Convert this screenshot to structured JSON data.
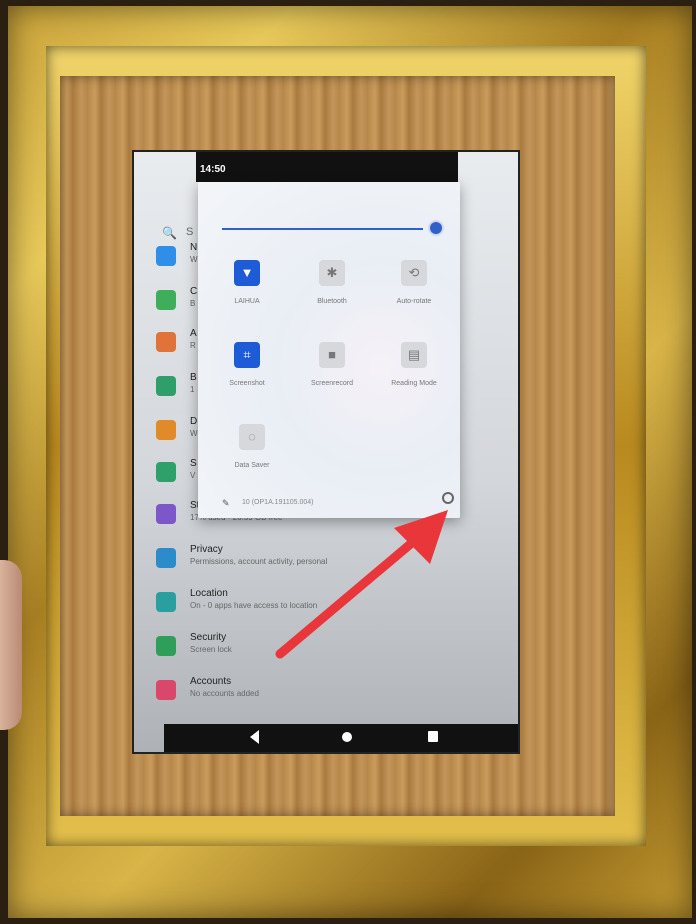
{
  "status_bar": {
    "time": "14:50"
  },
  "settings": {
    "search_hint": "S",
    "items": [
      {
        "title": "N",
        "subtitle": "W",
        "color": "#2f8ee8",
        "icon": "wifi-icon"
      },
      {
        "title": "C",
        "subtitle": "B",
        "color": "#3fae5a",
        "icon": "devices-icon"
      },
      {
        "title": "A",
        "subtitle": "R",
        "color": "#e0733a",
        "icon": "apps-icon"
      },
      {
        "title": "B",
        "subtitle": "1",
        "color": "#2e9e6a",
        "icon": "battery-icon"
      },
      {
        "title": "D",
        "subtitle": "W",
        "color": "#e08a2a",
        "icon": "display-icon"
      },
      {
        "title": "S",
        "subtitle": "V",
        "color": "#30a06a",
        "icon": "sound-icon"
      },
      {
        "title": "Storage",
        "subtitle": "17% used - 26.59 GB free",
        "color": "#7b57c9",
        "icon": "storage-icon"
      },
      {
        "title": "Privacy",
        "subtitle": "Permissions, account activity, personal",
        "color": "#2c8bc9",
        "icon": "privacy-icon"
      },
      {
        "title": "Location",
        "subtitle": "On - 0 apps have access to location",
        "color": "#2a9fa0",
        "icon": "location-icon"
      },
      {
        "title": "Security",
        "subtitle": "Screen lock",
        "color": "#2e9e5a",
        "icon": "lock-icon"
      },
      {
        "title": "Accounts",
        "subtitle": "No accounts added",
        "color": "#d9476a",
        "icon": "accounts-icon"
      }
    ]
  },
  "quick_settings": {
    "brightness_level": 0.95,
    "tiles": [
      {
        "label": "LAIHUA",
        "symbol": "▼",
        "active": true,
        "icon": "wifi-icon"
      },
      {
        "label": "Bluetooth",
        "symbol": "✱",
        "active": false,
        "icon": "bluetooth-icon"
      },
      {
        "label": "Auto-rotate",
        "symbol": "⟲",
        "active": false,
        "icon": "auto-rotate-icon"
      },
      {
        "label": "Screenshot",
        "symbol": "⌗",
        "active": true,
        "icon": "screenshot-icon"
      },
      {
        "label": "Screenrecord",
        "symbol": "■",
        "active": false,
        "icon": "screenrecord-icon"
      },
      {
        "label": "Reading Mode",
        "symbol": "▤",
        "active": false,
        "icon": "reading-mode-icon"
      },
      {
        "label": "Data Saver",
        "symbol": "◌",
        "active": false,
        "icon": "data-saver-icon"
      }
    ],
    "edit_symbol": "✎",
    "build_number": "10 (OP1A.191105.004)",
    "settings_symbol": "⚙"
  },
  "colors": {
    "accent": "#1e5bd6",
    "arrow": "#e8363a"
  }
}
